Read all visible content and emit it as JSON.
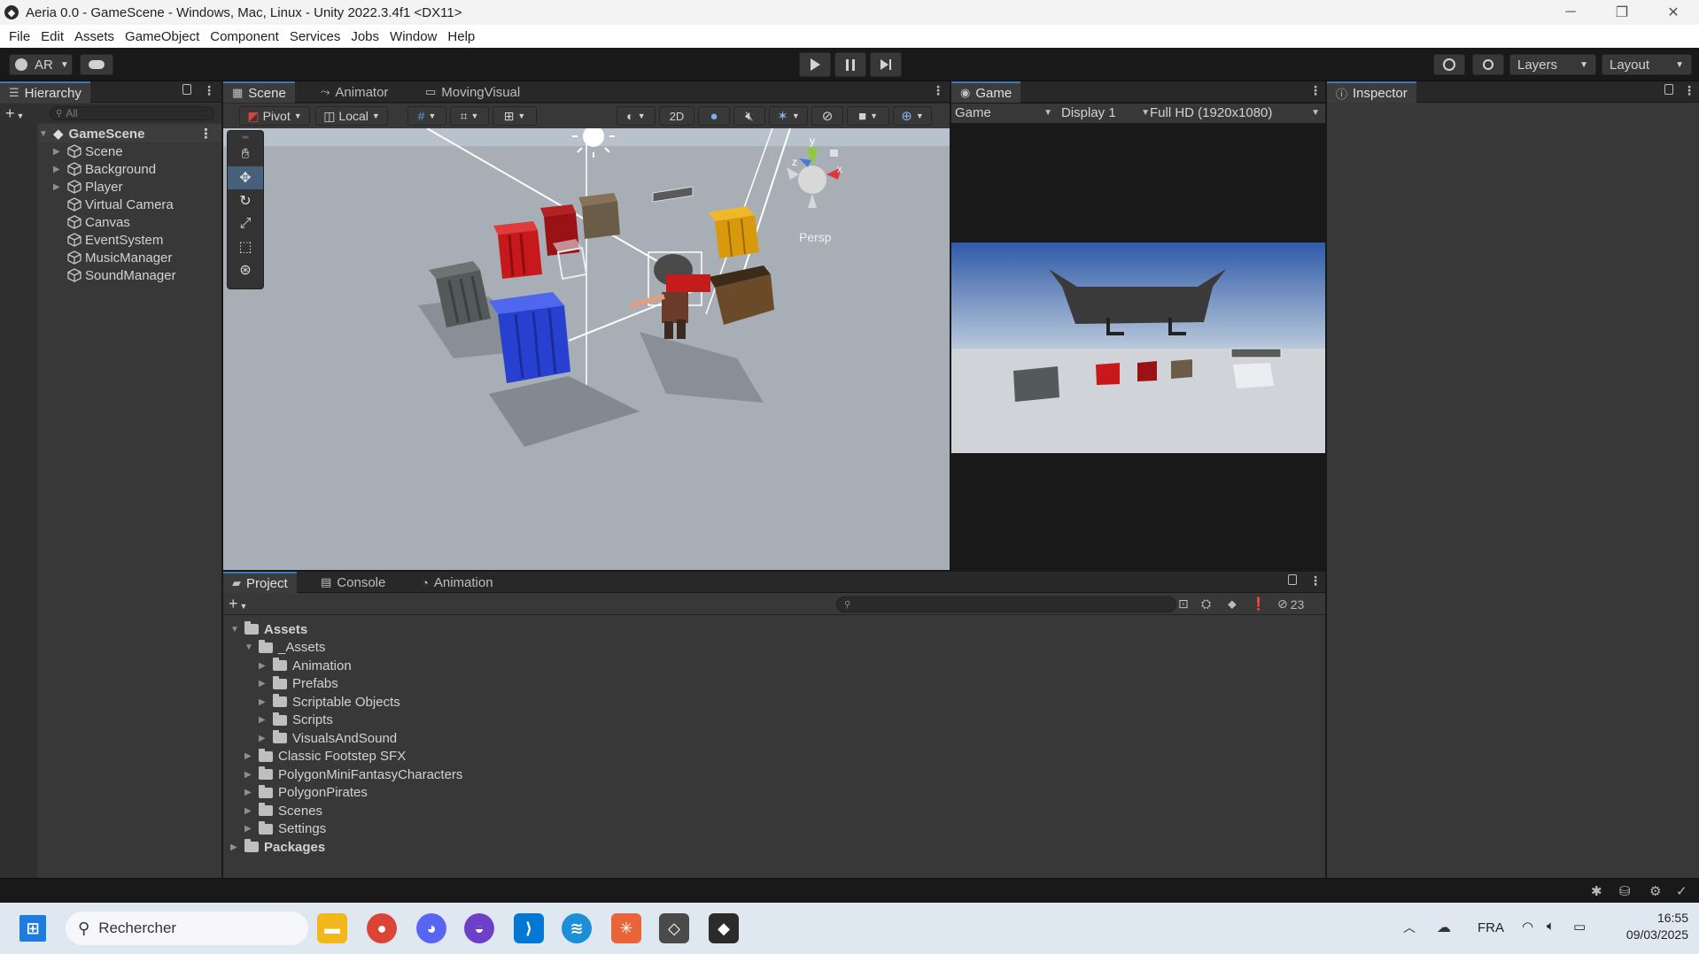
{
  "window": {
    "title": "Aeria 0.0 - GameScene - Windows, Mac, Linux - Unity 2022.3.4f1 <DX11>",
    "minimize": "─",
    "maximize": "❐",
    "close": "✕"
  },
  "menu": [
    "File",
    "Edit",
    "Assets",
    "GameObject",
    "Component",
    "Services",
    "Jobs",
    "Window",
    "Help"
  ],
  "toolbar": {
    "account": "AR",
    "layers": "Layers",
    "layout": "Layout"
  },
  "hierarchy": {
    "tab": "Hierarchy",
    "search_placeholder": "All",
    "scene": "GameScene",
    "items": [
      {
        "label": "Scene",
        "expandable": true
      },
      {
        "label": "Background",
        "expandable": true
      },
      {
        "label": "Player",
        "expandable": true
      },
      {
        "label": "Virtual Camera",
        "expandable": false
      },
      {
        "label": "Canvas",
        "expandable": false
      },
      {
        "label": "EventSystem",
        "expandable": false
      },
      {
        "label": "MusicManager",
        "expandable": false
      },
      {
        "label": "SoundManager",
        "expandable": false
      }
    ]
  },
  "scene_view": {
    "tabs": [
      "Scene",
      "Animator",
      "MovingVisual"
    ],
    "pivot": "Pivot",
    "space": "Local",
    "mode_2d": "2D",
    "persp": "Persp",
    "gizmo_axes": {
      "y": "y",
      "x": "x",
      "z": "z"
    }
  },
  "game_view": {
    "tab": "Game",
    "mode": "Game",
    "display": "Display 1",
    "resolution": "Full HD (1920x1080)"
  },
  "inspector": {
    "tab": "Inspector"
  },
  "project": {
    "tabs": [
      "Project",
      "Console",
      "Animation"
    ],
    "hidden_count": "23",
    "tree": [
      {
        "label": "Assets",
        "level": 0,
        "open": true,
        "bold": true
      },
      {
        "label": "_Assets",
        "level": 1,
        "open": true,
        "bold": false
      },
      {
        "label": "Animation",
        "level": 2,
        "open": false,
        "bold": false
      },
      {
        "label": "Prefabs",
        "level": 2,
        "open": false,
        "bold": false
      },
      {
        "label": "Scriptable Objects",
        "level": 2,
        "open": false,
        "bold": false
      },
      {
        "label": "Scripts",
        "level": 2,
        "open": false,
        "bold": false
      },
      {
        "label": "VisualsAndSound",
        "level": 2,
        "open": false,
        "bold": false
      },
      {
        "label": "Classic Footstep SFX",
        "level": 1,
        "open": false,
        "bold": false
      },
      {
        "label": "PolygonMiniFantasyCharacters",
        "level": 1,
        "open": false,
        "bold": false
      },
      {
        "label": "PolygonPirates",
        "level": 1,
        "open": false,
        "bold": false
      },
      {
        "label": "Scenes",
        "level": 1,
        "open": false,
        "bold": false
      },
      {
        "label": "Settings",
        "level": 1,
        "open": false,
        "bold": false
      },
      {
        "label": "Packages",
        "level": 0,
        "open": false,
        "bold": true
      }
    ]
  },
  "taskbar": {
    "search": "Rechercher",
    "lang": "FRA",
    "time": "16:55",
    "date": "09/03/2025"
  },
  "colors": {
    "accent": "#3a79bb",
    "panel": "#383838",
    "dark": "#191919",
    "crate_red": "#c4191c",
    "crate_blue": "#2c46d8",
    "crate_yellow": "#e0a010"
  }
}
